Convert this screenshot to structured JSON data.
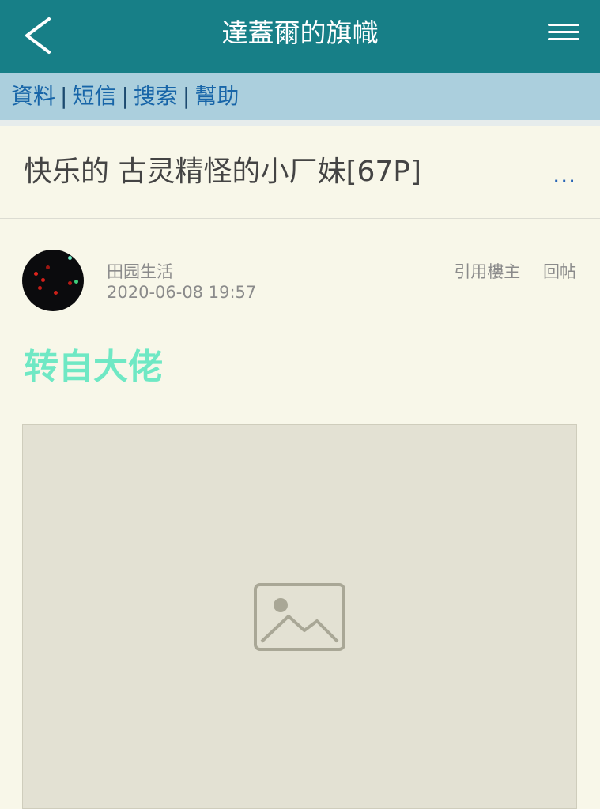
{
  "header": {
    "title": "達蓋爾的旗幟",
    "back_icon": "back-chevron-icon",
    "menu_icon": "hamburger-menu-icon",
    "bg_color": "#177f87"
  },
  "subnav": {
    "items": [
      "資料",
      "短信",
      "搜索",
      "幫助"
    ],
    "separator": "|",
    "bg_color": "#abcfdd"
  },
  "thread": {
    "title": "快乐的 古灵精怪的小厂妹[67P]",
    "more_label": "..."
  },
  "post": {
    "author": "田园生活",
    "timestamp": "2020-06-08 19:57",
    "actions": [
      "引用樓主",
      "回帖"
    ],
    "heading": "转自大佬",
    "heading_color": "#6fe8c4",
    "image_icon": "image-placeholder-icon"
  }
}
